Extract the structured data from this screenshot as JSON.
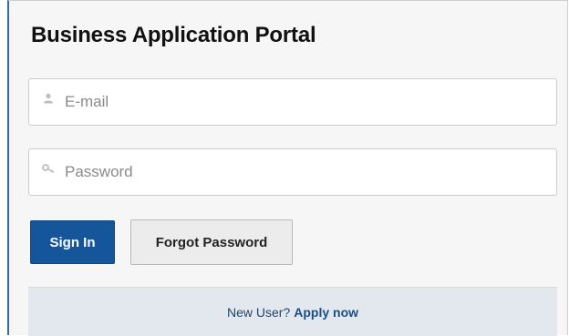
{
  "page": {
    "title": "Business Application Portal"
  },
  "form": {
    "email": {
      "placeholder": "E-mail",
      "value": "",
      "icon": "user-icon"
    },
    "password": {
      "placeholder": "Password",
      "value": "",
      "icon": "key-icon"
    }
  },
  "actions": {
    "sign_in_label": "Sign In",
    "forgot_password_label": "Forgot Password"
  },
  "footer": {
    "prompt": "New User?",
    "apply_link": "Apply now"
  },
  "colors": {
    "primary": "#15569a",
    "panel_bg": "#f6f6f6",
    "footer_bg": "#e3e8ee",
    "accent_border": "#2e6da4"
  }
}
